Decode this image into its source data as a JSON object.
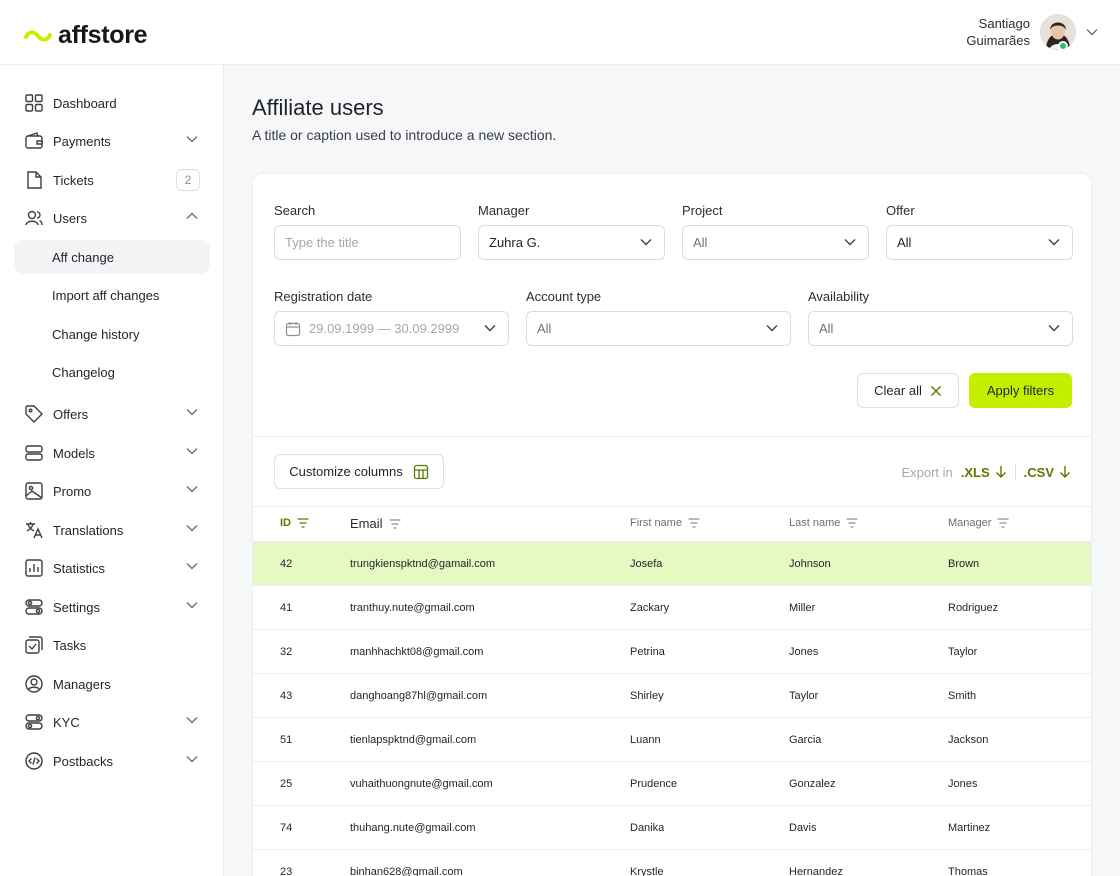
{
  "brand": {
    "name": "affstore",
    "accent": "#c4f000",
    "accent_dark": "#5a7a00"
  },
  "user": {
    "first": "Santiago",
    "last": "Guimarães",
    "status_color": "#22c55e"
  },
  "sidebar": {
    "items": [
      {
        "label": "Dashboard",
        "icon": "dashboard-icon"
      },
      {
        "label": "Payments",
        "icon": "wallet-icon"
      },
      {
        "label": "Tickets",
        "icon": "ticket-icon",
        "badge": "2"
      },
      {
        "label": "Users",
        "icon": "users-icon"
      },
      {
        "label": "Aff change"
      },
      {
        "label": "Import aff changes"
      },
      {
        "label": "Change history"
      },
      {
        "label": "Changelog"
      },
      {
        "label": "Offers",
        "icon": "tag-icon"
      },
      {
        "label": "Models",
        "icon": "models-icon"
      },
      {
        "label": "Promo",
        "icon": "image-icon"
      },
      {
        "label": "Translations",
        "icon": "translate-icon"
      },
      {
        "label": "Statistics",
        "icon": "chart-icon"
      },
      {
        "label": "Settings",
        "icon": "toggles-icon"
      },
      {
        "label": "Tasks",
        "icon": "tasks-icon"
      },
      {
        "label": "Managers",
        "icon": "manager-icon"
      },
      {
        "label": "KYC",
        "icon": "kyc-icon"
      },
      {
        "label": "Postbacks",
        "icon": "code-icon"
      }
    ]
  },
  "page": {
    "title": "Affiliate users",
    "subtitle": "A title or caption used to introduce a new section."
  },
  "filters": {
    "search": {
      "label": "Search",
      "placeholder": "Type the title"
    },
    "manager": {
      "label": "Manager",
      "value": "Zuhra G."
    },
    "project": {
      "label": "Project",
      "value": "All"
    },
    "offer": {
      "label": "Offer",
      "value": "All"
    },
    "registration_date": {
      "label": "Registration date",
      "value": "29.09.1999 — 30.09.2999"
    },
    "account_type": {
      "label": "Account type",
      "value": "All"
    },
    "availability": {
      "label": "Availability",
      "value": "All"
    },
    "clear_label": "Clear all",
    "apply_label": "Apply filters"
  },
  "toolbar": {
    "customize_label": "Customize columns",
    "export_label": "Export in",
    "xls_label": ".XLS",
    "csv_label": ".CSV"
  },
  "table": {
    "columns": [
      "ID",
      "Email",
      "First name",
      "Last name",
      "Manager"
    ],
    "rows": [
      {
        "id": "42",
        "email": "trungkienspktnd@gamail.com",
        "first": "Josefa",
        "last": "Johnson",
        "manager": "Brown"
      },
      {
        "id": "41",
        "email": "tranthuy.nute@gmail.com",
        "first": "Zackary",
        "last": "Miller",
        "manager": "Rodriguez"
      },
      {
        "id": "32",
        "email": "manhhachkt08@gmail.com",
        "first": "Petrina",
        "last": "Jones",
        "manager": "Taylor"
      },
      {
        "id": "43",
        "email": "danghoang87hl@gmail.com",
        "first": "Shirley",
        "last": "Taylor",
        "manager": "Smith"
      },
      {
        "id": "51",
        "email": "tienlapspktnd@gmail.com",
        "first": "Luann",
        "last": "Garcia",
        "manager": "Jackson"
      },
      {
        "id": "25",
        "email": "vuhaithuongnute@gmail.com",
        "first": "Prudence",
        "last": "Gonzalez",
        "manager": "Jones"
      },
      {
        "id": "74",
        "email": "thuhang.nute@gmail.com",
        "first": "Danika",
        "last": "Davis",
        "manager": "Martinez"
      },
      {
        "id": "23",
        "email": "binhan628@gmail.com",
        "first": "Krystle",
        "last": "Hernandez",
        "manager": "Thomas"
      }
    ]
  }
}
